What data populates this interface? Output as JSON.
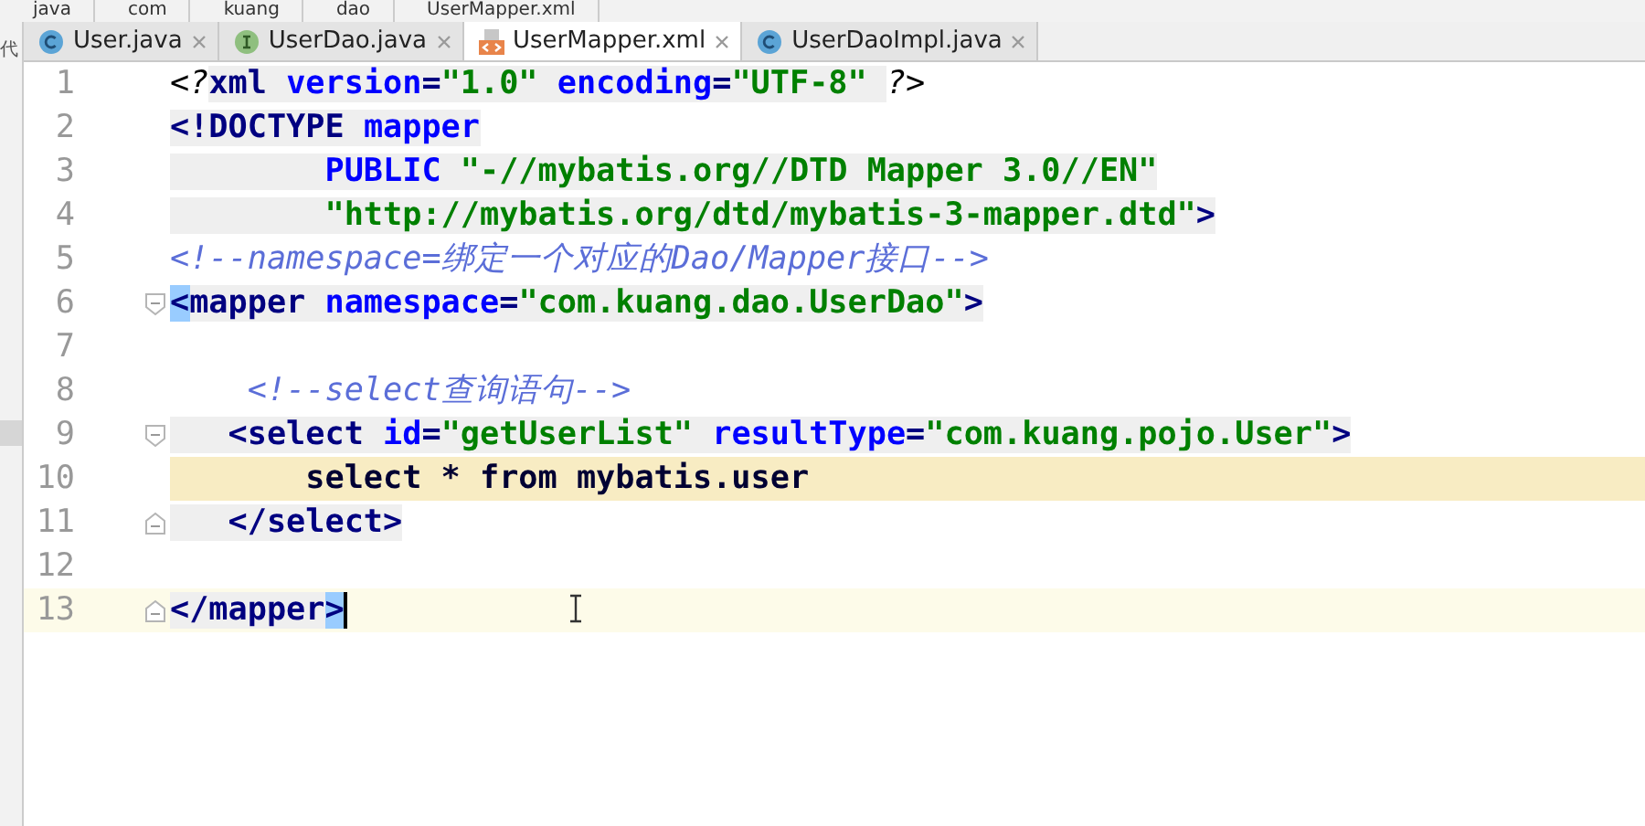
{
  "breadcrumbs": [
    "java",
    "com",
    "kuang",
    "dao",
    "UserMapper.xml"
  ],
  "side_text": "代",
  "tabs": [
    {
      "label": "User.java",
      "kind": "class",
      "selected": false
    },
    {
      "label": "UserDao.java",
      "kind": "interface",
      "selected": false
    },
    {
      "label": "UserMapper.xml",
      "kind": "xml",
      "selected": true
    },
    {
      "label": "UserDaoImpl.java",
      "kind": "class",
      "selected": false
    }
  ],
  "lines": [
    {
      "number": "1",
      "fold_start": false,
      "fold_end": false,
      "current": false,
      "in_block": false,
      "tokens": [
        {
          "kind": "pi",
          "text": "<?"
        },
        {
          "kind": "tag",
          "text": "xml "
        },
        {
          "kind": "attr",
          "text": "version"
        },
        {
          "kind": "tag",
          "text": "="
        },
        {
          "kind": "value",
          "text": "\"1.0\" "
        },
        {
          "kind": "attr",
          "text": "encoding"
        },
        {
          "kind": "tag",
          "text": "="
        },
        {
          "kind": "value",
          "text": "\"UTF-8\" "
        },
        {
          "kind": "pi",
          "text": "?>"
        }
      ]
    },
    {
      "number": "2",
      "fold_start": false,
      "fold_end": false,
      "current": false,
      "in_block": false,
      "tokens": [
        {
          "kind": "tag",
          "text": "<!DOCTYPE "
        },
        {
          "kind": "attr",
          "text": "mapper"
        }
      ]
    },
    {
      "number": "3",
      "fold_start": false,
      "fold_end": false,
      "current": false,
      "in_block": false,
      "tokens": [
        {
          "kind": "attr",
          "text": "        PUBLIC "
        },
        {
          "kind": "value",
          "text": "\"-//mybatis.org//DTD Mapper 3.0//EN\""
        }
      ]
    },
    {
      "number": "4",
      "fold_start": false,
      "fold_end": false,
      "current": false,
      "in_block": false,
      "tokens": [
        {
          "kind": "value",
          "text": "        \"http://mybatis.org/dtd/mybatis-3-mapper.dtd\""
        },
        {
          "kind": "tag",
          "text": ">"
        }
      ]
    },
    {
      "number": "5",
      "fold_start": false,
      "fold_end": false,
      "current": false,
      "in_block": false,
      "tokens": [
        {
          "kind": "comment",
          "text": "<!--namespace=绑定一个对应的Dao/Mapper接口-->"
        }
      ]
    },
    {
      "number": "6",
      "fold_start": true,
      "fold_end": false,
      "current": false,
      "in_block": false,
      "tokens": [
        {
          "kind": "match",
          "text": "<"
        },
        {
          "kind": "tag",
          "text": "mapper "
        },
        {
          "kind": "attr",
          "text": "namespace"
        },
        {
          "kind": "tag",
          "text": "="
        },
        {
          "kind": "value",
          "text": "\"com.kuang.dao.UserDao\""
        },
        {
          "kind": "tag",
          "text": ">"
        }
      ]
    },
    {
      "number": "7",
      "fold_start": false,
      "fold_end": false,
      "current": false,
      "in_block": false
    },
    {
      "number": "8",
      "fold_start": false,
      "fold_end": false,
      "current": false,
      "in_block": false,
      "tokens": [
        {
          "kind": "comment",
          "text": "    <!--select查询语句-->"
        }
      ]
    },
    {
      "number": "9",
      "fold_start": true,
      "fold_end": false,
      "current": false,
      "in_block": false,
      "tokens": [
        {
          "kind": "tag",
          "text": "   <select "
        },
        {
          "kind": "attr",
          "text": "id"
        },
        {
          "kind": "tag",
          "text": "="
        },
        {
          "kind": "value",
          "text": "\"getUserList\" "
        },
        {
          "kind": "attr",
          "text": "resultType"
        },
        {
          "kind": "tag",
          "text": "="
        },
        {
          "kind": "value",
          "text": "\"com.kuang.pojo.User\""
        },
        {
          "kind": "tag",
          "text": ">"
        }
      ]
    },
    {
      "number": "10",
      "fold_start": false,
      "fold_end": false,
      "current": false,
      "in_block": true,
      "tokens": [
        {
          "kind": "sql",
          "text": "       select * from mybatis.user"
        }
      ]
    },
    {
      "number": "11",
      "fold_start": false,
      "fold_end": true,
      "current": false,
      "in_block": false,
      "tokens": [
        {
          "kind": "tag",
          "text": "   </select>"
        }
      ]
    },
    {
      "number": "12",
      "fold_start": false,
      "fold_end": false,
      "current": false,
      "in_block": false
    },
    {
      "number": "13",
      "fold_start": false,
      "fold_end": true,
      "current": true,
      "in_block": false,
      "tokens": [
        {
          "kind": "tag",
          "text": "</mapper"
        },
        {
          "kind": "match",
          "text": ">"
        }
      ]
    }
  ]
}
